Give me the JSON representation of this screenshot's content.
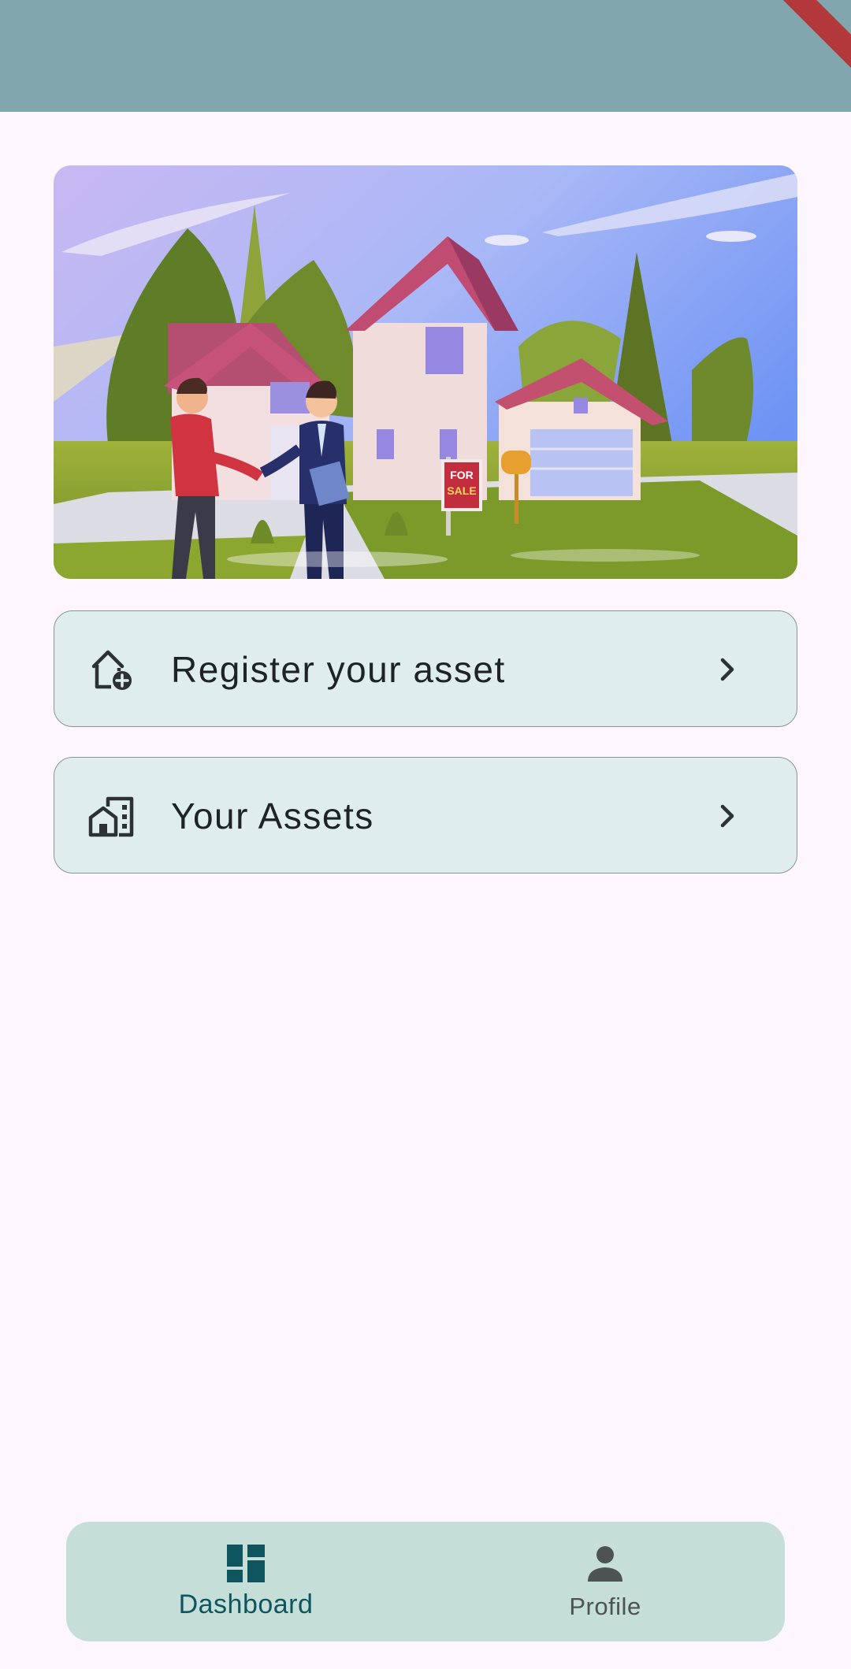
{
  "app_bar": {
    "color": "#80a5ac"
  },
  "hero": {
    "sign_line1": "FOR",
    "sign_line2": "SALE"
  },
  "actions": [
    {
      "label": "Register your asset",
      "icon": "home-add-icon"
    },
    {
      "label": "Your Assets",
      "icon": "buildings-icon"
    }
  ],
  "bottom_nav": {
    "items": [
      {
        "label": "Dashboard",
        "icon": "dashboard-icon",
        "selected": true
      },
      {
        "label": "Profile",
        "icon": "person-icon",
        "selected": false
      }
    ]
  },
  "colors": {
    "background": "#fdf6fc",
    "card": "#dfeeed",
    "nav": "#c6ded8",
    "accent": "#0f5560"
  }
}
